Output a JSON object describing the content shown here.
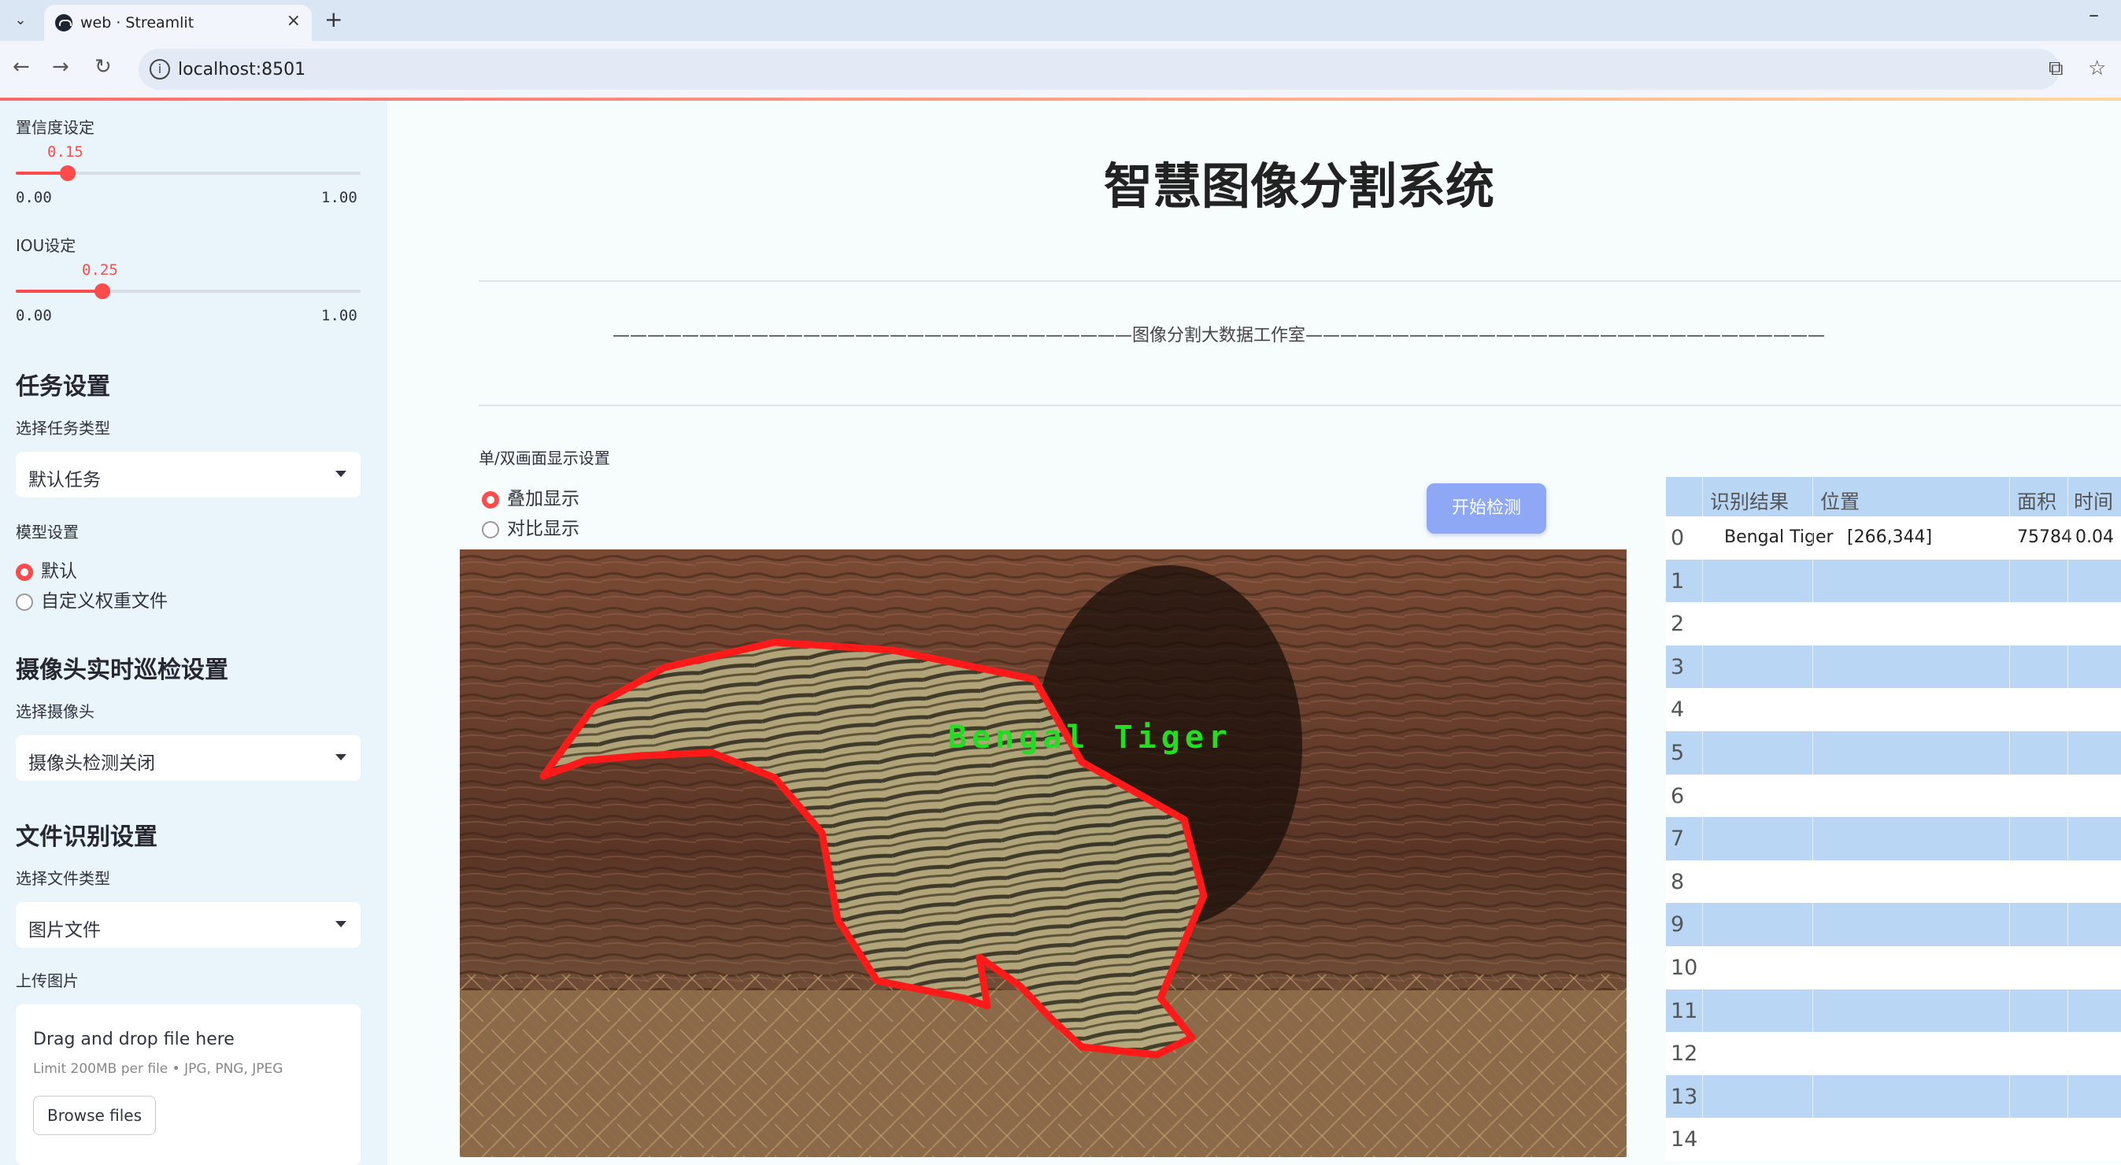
{
  "browser": {
    "tab_title": "web · Streamlit",
    "url": "localhost:8501",
    "new_tab": "+",
    "close_tab": "×",
    "minimize": "–"
  },
  "sidebar": {
    "confidence": {
      "label": "置信度设定",
      "value": "0.15",
      "min": "0.00",
      "max": "1.00",
      "fraction": 0.15
    },
    "iou": {
      "label": "IOU设定",
      "value": "0.25",
      "min": "0.00",
      "max": "1.00",
      "fraction": 0.25
    },
    "task": {
      "heading": "任务设置",
      "select_label": "选择任务类型",
      "selected": "默认任务"
    },
    "model": {
      "label": "模型设置",
      "options": [
        "默认",
        "自定义权重文件"
      ],
      "selected_index": 0
    },
    "camera": {
      "heading": "摄像头实时巡检设置",
      "select_label": "选择摄像头",
      "selected": "摄像头检测关闭"
    },
    "file": {
      "heading": "文件识别设置",
      "select_label": "选择文件类型",
      "selected": "图片文件"
    },
    "upload": {
      "label": "上传图片",
      "drop_text": "Drag and drop file here",
      "limit_text": "Limit 200MB per file • JPG, PNG, JPEG",
      "browse_label": "Browse files"
    }
  },
  "main": {
    "title": "智慧图像分割系统",
    "banner": "——————————————————————————————图像分割大数据工作室——————————————————————————————",
    "display_label": "单/双画面显示设置",
    "display_options": [
      "叠加显示",
      "对比显示"
    ],
    "display_selected": 0,
    "detect_button": "开始检测",
    "detection_label": "Bengal Tiger"
  },
  "table": {
    "headers": [
      "识别结果",
      "位置",
      "面积",
      "时间"
    ],
    "rows": [
      {
        "index": "0",
        "result": "Bengal Tiger",
        "position": "[266,344]",
        "area": "75784",
        "time": "0.04"
      },
      {
        "index": "1"
      },
      {
        "index": "2"
      },
      {
        "index": "3"
      },
      {
        "index": "4"
      },
      {
        "index": "5"
      },
      {
        "index": "6"
      },
      {
        "index": "7"
      },
      {
        "index": "8"
      },
      {
        "index": "9"
      },
      {
        "index": "10"
      },
      {
        "index": "11"
      },
      {
        "index": "12"
      },
      {
        "index": "13"
      },
      {
        "index": "14"
      }
    ]
  },
  "colors": {
    "accent": "#ff4b4b",
    "button": "#8fa8f5",
    "table_stripe": "#b9d7f5",
    "mask_outline": "#ff1a1a",
    "label_text": "#22dd22"
  }
}
